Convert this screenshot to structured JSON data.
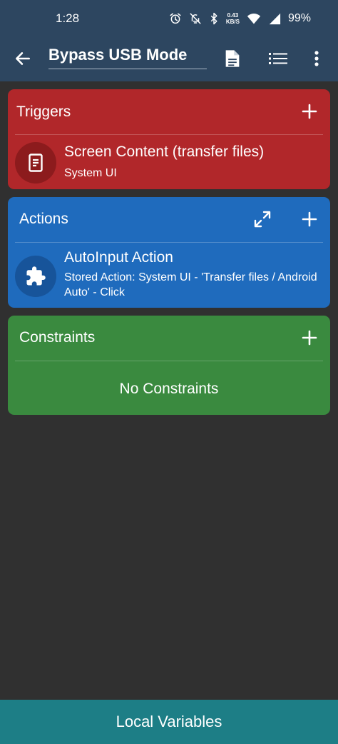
{
  "status_bar": {
    "time": "1:28",
    "net_speed_value": "0.43",
    "net_speed_unit": "KB/S",
    "battery": "99%",
    "icons": [
      "alarm-icon",
      "notifications-off-icon",
      "bluetooth-icon",
      "wifi-icon",
      "signal-icon"
    ]
  },
  "toolbar": {
    "back_icon": "arrow-left-icon",
    "title": "Bypass USB Mode",
    "actions": [
      "document-icon",
      "list-icon",
      "more-vert-icon"
    ]
  },
  "triggers": {
    "title": "Triggers",
    "color": "#b1272a",
    "items": [
      {
        "icon": "screen-content-icon",
        "title": "Screen Content (transfer files)",
        "subtitle": "System UI"
      }
    ]
  },
  "actions": {
    "title": "Actions",
    "color": "#1f6bbd",
    "items": [
      {
        "icon": "puzzle-icon",
        "title": "AutoInput Action",
        "subtitle": "Stored Action: System UI - 'Transfer files / Android Auto' - Click"
      }
    ]
  },
  "constraints": {
    "title": "Constraints",
    "color": "#3a8a3f",
    "empty_text": "No Constraints"
  },
  "bottom_bar": {
    "label": "Local Variables",
    "color": "#1d7e86"
  }
}
